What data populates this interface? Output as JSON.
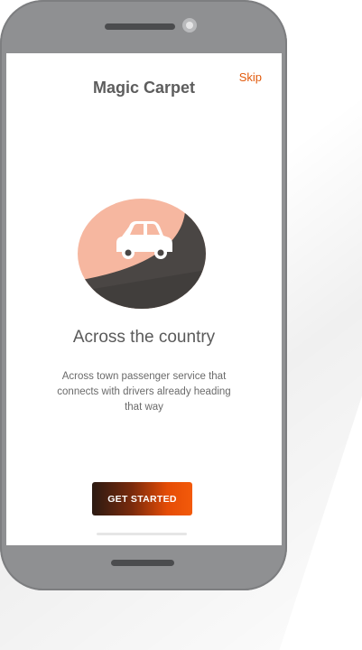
{
  "app": {
    "title": "Magic Carpet",
    "skip_label": "Skip"
  },
  "onboarding": {
    "headline": "Across the country",
    "description": "Across town passenger service that connects with drivers already heading that way",
    "cta_label": "GET STARTED",
    "illustration_icon": "car-icon"
  },
  "colors": {
    "accent": "#e25a0c",
    "illustration_peach": "#f6b7a0",
    "illustration_dark": "#4a4644",
    "button_gradient_start": "#2b1a12",
    "button_gradient_end": "#f35a0a"
  }
}
